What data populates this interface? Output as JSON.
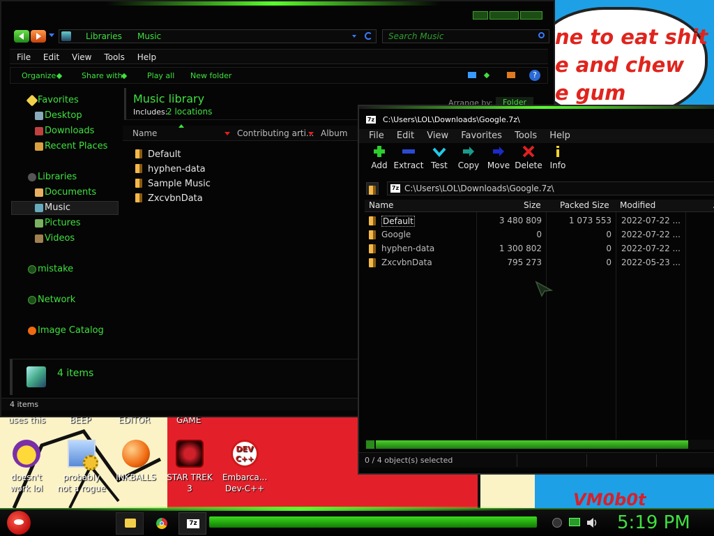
{
  "explorer": {
    "breadcrumb": [
      "Libraries",
      "Music"
    ],
    "search_placeholder": "Search Music",
    "menu": [
      "File",
      "Edit",
      "View",
      "Tools",
      "Help"
    ],
    "toolbar": [
      "Organize",
      "Share with",
      "Play all",
      "New folder"
    ],
    "nav": [
      "Favorites",
      "Desktop",
      "Downloads",
      "Recent Places",
      "Libraries",
      "Documents",
      "Music",
      "Pictures",
      "Videos",
      "mistake",
      "Network",
      "Image Catalog"
    ],
    "library_title": "Music library",
    "includes_label": "Includes:",
    "includes_link": "2 locations",
    "arrange_label": "Arrange by:",
    "arrange_value": "Folder",
    "columns": [
      "Name",
      "Contributing arti...",
      "Album"
    ],
    "files": [
      "Default",
      "hyphen-data",
      "Sample Music",
      "ZxcvbnData"
    ],
    "details_count": "4 items",
    "status": "4 items"
  },
  "zip": {
    "title": "C:\\Users\\LOL\\Downloads\\Google.7z\\",
    "menu": [
      "File",
      "Edit",
      "View",
      "Favorites",
      "Tools",
      "Help"
    ],
    "toolbar": [
      "Add",
      "Extract",
      "Test",
      "Copy",
      "Move",
      "Delete",
      "Info"
    ],
    "path": "C:\\Users\\LOL\\Downloads\\Google.7z\\",
    "columns": [
      "Name",
      "Size",
      "Packed Size",
      "Modified",
      "A"
    ],
    "rows": [
      {
        "name": "Default",
        "size": "3 480 809",
        "packed": "1 073 553",
        "modified": "2022-07-22 ..."
      },
      {
        "name": "Google",
        "size": "0",
        "packed": "0",
        "modified": "2022-07-22 ..."
      },
      {
        "name": "hyphen-data",
        "size": "1 300 802",
        "packed": "0",
        "modified": "2022-07-22 ..."
      },
      {
        "name": "ZxcvbnData",
        "size": "795 273",
        "packed": "0",
        "modified": "2022-05-23 ..."
      }
    ],
    "status": "0 / 4 object(s) selected"
  },
  "wallpaper": {
    "lines": [
      "ne to eat shit",
      "e and chew",
      "e gum"
    ],
    "signature": "VM0b0t"
  },
  "desktop": {
    "top_labels": [
      "uses this",
      "BEEP",
      "EDITOR",
      "GAME"
    ],
    "icons": [
      {
        "label": "doesn't work lol",
        "icon": "yahoo-messenger-icon"
      },
      {
        "label": "probably not a rogue",
        "icon": "gear-monitor-icon"
      },
      {
        "label": "INKBALLS",
        "icon": "inkball-icon"
      },
      {
        "label": "STAR TREK 3",
        "icon": "star-wars-game-icon"
      },
      {
        "label": "Embarca... Dev-C++",
        "icon": "devcpp-icon"
      }
    ]
  },
  "taskbar": {
    "clock": "5:19 PM"
  },
  "colors": {
    "accent_green": "#3fe03f",
    "window_bg": "#050505",
    "desktop_blue": "#1ea0e6"
  }
}
